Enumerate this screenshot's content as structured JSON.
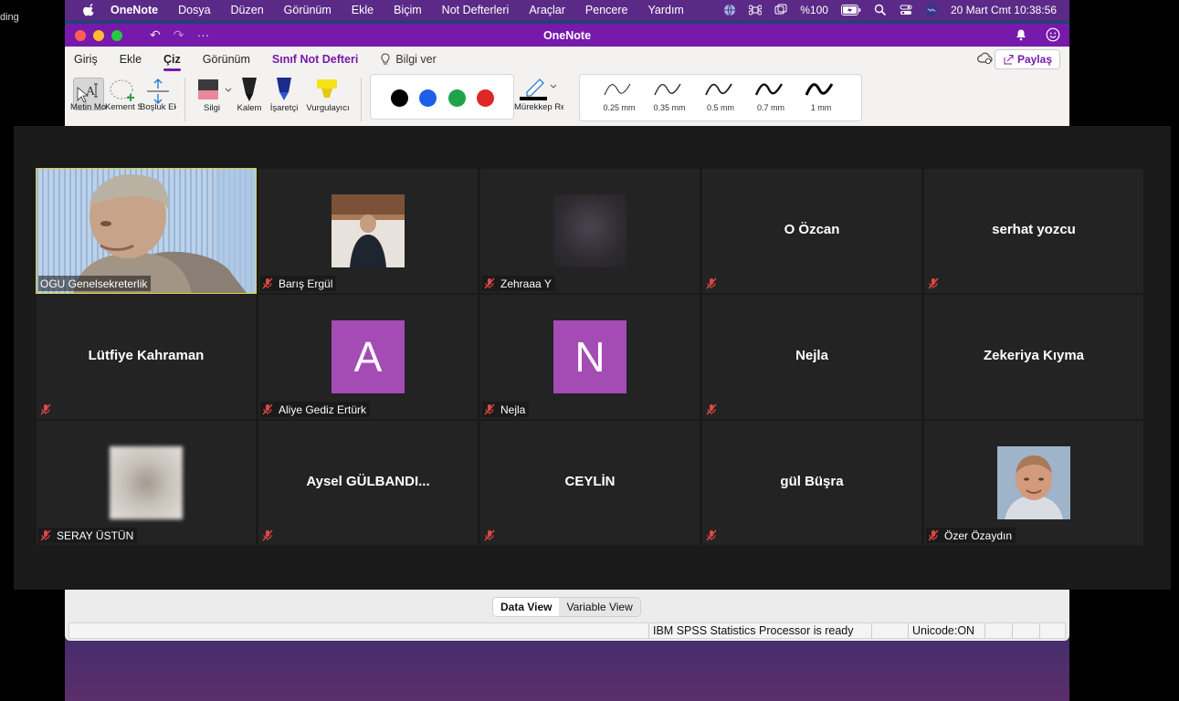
{
  "recording": {
    "text": "ding"
  },
  "menubar": {
    "app": "OneNote",
    "items": [
      "Dosya",
      "Düzen",
      "Görünüm",
      "Ekle",
      "Biçim",
      "Not Defterleri",
      "Araçlar",
      "Pencere",
      "Yardım"
    ],
    "battery": "%100",
    "datetime": "20 Mart Cmt  10:38:56"
  },
  "onenote": {
    "title": "OneNote",
    "tabs": [
      "Giriş",
      "Ekle",
      "Çiz",
      "Görünüm",
      "Sınıf Not Defteri"
    ],
    "active_tab": "Çiz",
    "tell_me": "Bilgi ver",
    "share": "Paylaş",
    "tools": {
      "text_mode": "Metin Modu",
      "lasso": "Kement Seçimi",
      "space": "Boşluk Ekle",
      "eraser": "Silgi",
      "pen": "Kalem",
      "marker": "İşaretçi",
      "highlighter": "Vurgulayıcı",
      "ink_color": "Mürekkep Rengi"
    },
    "pen_colors": [
      "#000000",
      "#1f5ee6",
      "#1ea34a",
      "#e02626"
    ],
    "thicknesses": [
      "0.25 mm",
      "0.35 mm",
      "0.5 mm",
      "0.7 mm",
      "1 mm"
    ]
  },
  "zoom": {
    "participants": [
      {
        "name": "OGU Genelsekreterlik",
        "kind": "video",
        "speaking": true
      },
      {
        "name": "Barış Ergül",
        "kind": "photo"
      },
      {
        "name": "Zehraaa Y",
        "kind": "blurred"
      },
      {
        "name": "O Özcan",
        "kind": "name"
      },
      {
        "name": "serhat yozcu",
        "kind": "name"
      },
      {
        "name": "Lütfiye Kahraman",
        "kind": "name"
      },
      {
        "name": "Aliye Gediz Ertürk",
        "kind": "letter",
        "letter": "A"
      },
      {
        "name": "Nejla",
        "kind": "letter",
        "letter": "N"
      },
      {
        "name": "Nejla",
        "kind": "name"
      },
      {
        "name": "Zekeriya Kıyma",
        "kind": "name"
      },
      {
        "name": "SERAY ÜSTÜN",
        "kind": "blurred-light"
      },
      {
        "name": "Aysel  GÜLBANDI...",
        "kind": "name"
      },
      {
        "name": "CEYLİN",
        "kind": "name"
      },
      {
        "name": "gül Büşra",
        "kind": "name"
      },
      {
        "name": "Özer Özaydın",
        "kind": "portrait"
      }
    ]
  },
  "spss": {
    "tabs": [
      "Data View",
      "Variable View"
    ],
    "active_tab": "Data View",
    "status": "IBM SPSS Statistics Processor is ready",
    "unicode": "Unicode:ON"
  }
}
